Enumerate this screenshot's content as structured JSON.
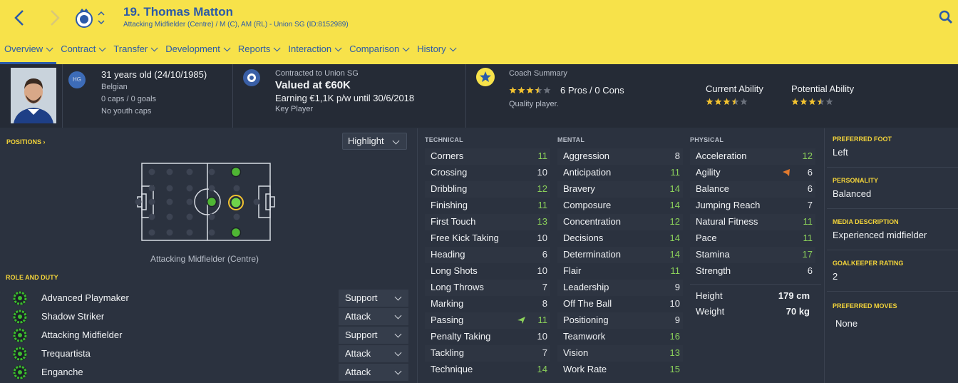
{
  "header": {
    "player_title": "19. Thomas Matton",
    "player_sub": "Attacking Midfielder (Centre) / M (C), AM (RL) - Union SG (ID:8152989)",
    "tabs": [
      {
        "label": "Overview"
      },
      {
        "label": "Contract"
      },
      {
        "label": "Transfer"
      },
      {
        "label": "Development"
      },
      {
        "label": "Reports"
      },
      {
        "label": "Interaction"
      },
      {
        "label": "Comparison"
      },
      {
        "label": "History"
      }
    ]
  },
  "info": {
    "hg_badge": "HG",
    "age": "31 years old (24/10/1985)",
    "nationality": "Belgian",
    "caps": "0 caps / 0 goals",
    "youth_caps": "No youth caps",
    "contract_label": "Contracted to Union SG",
    "value": "Valued at €60K",
    "earning": "Earning €1,1K p/w until 30/6/2018",
    "squad_status": "Key Player",
    "coach_label": "Coach Summary",
    "coach_stars": 3.5,
    "pros_cons": "6 Pros / 0 Cons",
    "coach_verdict": "Quality player.",
    "current_ability_label": "Current Ability",
    "current_ability_stars": 3.5,
    "potential_ability_label": "Potential Ability",
    "potential_ability_stars": 3.5
  },
  "positions": {
    "title": "POSITIONS",
    "highlight": "Highlight",
    "caption": "Attacking Midfielder (Centre)"
  },
  "roles": {
    "title": "ROLE AND DUTY",
    "items": [
      {
        "name": "Advanced Playmaker",
        "duty": "Support"
      },
      {
        "name": "Shadow Striker",
        "duty": "Attack"
      },
      {
        "name": "Attacking Midfielder",
        "duty": "Support"
      },
      {
        "name": "Trequartista",
        "duty": "Attack"
      },
      {
        "name": "Enganche",
        "duty": "Attack"
      }
    ]
  },
  "technical": {
    "title": "TECHNICAL",
    "items": [
      {
        "name": "Corners",
        "value": "11"
      },
      {
        "name": "Crossing",
        "value": "10"
      },
      {
        "name": "Dribbling",
        "value": "12"
      },
      {
        "name": "Finishing",
        "value": "11"
      },
      {
        "name": "First Touch",
        "value": "13"
      },
      {
        "name": "Free Kick Taking",
        "value": "10"
      },
      {
        "name": "Heading",
        "value": "6"
      },
      {
        "name": "Long Shots",
        "value": "10"
      },
      {
        "name": "Long Throws",
        "value": "7"
      },
      {
        "name": "Marking",
        "value": "8"
      },
      {
        "name": "Passing",
        "value": "11"
      },
      {
        "name": "Penalty Taking",
        "value": "10"
      },
      {
        "name": "Tackling",
        "value": "7"
      },
      {
        "name": "Technique",
        "value": "14"
      }
    ]
  },
  "mental": {
    "title": "MENTAL",
    "items": [
      {
        "name": "Aggression",
        "value": "8"
      },
      {
        "name": "Anticipation",
        "value": "11"
      },
      {
        "name": "Bravery",
        "value": "14"
      },
      {
        "name": "Composure",
        "value": "14"
      },
      {
        "name": "Concentration",
        "value": "12"
      },
      {
        "name": "Decisions",
        "value": "14"
      },
      {
        "name": "Determination",
        "value": "14"
      },
      {
        "name": "Flair",
        "value": "11"
      },
      {
        "name": "Leadership",
        "value": "9"
      },
      {
        "name": "Off The Ball",
        "value": "10"
      },
      {
        "name": "Positioning",
        "value": "9"
      },
      {
        "name": "Teamwork",
        "value": "16"
      },
      {
        "name": "Vision",
        "value": "13"
      },
      {
        "name": "Work Rate",
        "value": "15"
      }
    ]
  },
  "physical": {
    "title": "PHYSICAL",
    "items": [
      {
        "name": "Acceleration",
        "value": "12"
      },
      {
        "name": "Agility",
        "value": "6"
      },
      {
        "name": "Balance",
        "value": "6"
      },
      {
        "name": "Jumping Reach",
        "value": "7"
      },
      {
        "name": "Natural Fitness",
        "value": "11"
      },
      {
        "name": "Pace",
        "value": "11"
      },
      {
        "name": "Stamina",
        "value": "17"
      },
      {
        "name": "Strength",
        "value": "6"
      }
    ],
    "height_label": "Height",
    "height_value": "179 cm",
    "weight_label": "Weight",
    "weight_value": "70 kg"
  },
  "side": {
    "preferred_foot_label": "PREFERRED FOOT",
    "preferred_foot": "Left",
    "personality_label": "PERSONALITY",
    "personality": "Balanced",
    "media_label": "MEDIA DESCRIPTION",
    "media": "Experienced midfielder",
    "gk_label": "GOALKEEPER RATING",
    "gk": "2",
    "moves_label": "PREFERRED MOVES",
    "moves": "None"
  },
  "colors": {
    "header_bg": "#f7e24a",
    "header_text": "#2b5aa8",
    "panel_bg": "#2b323f",
    "accent_yellow": "#f2d33a",
    "good_value": "#8bd15a"
  }
}
